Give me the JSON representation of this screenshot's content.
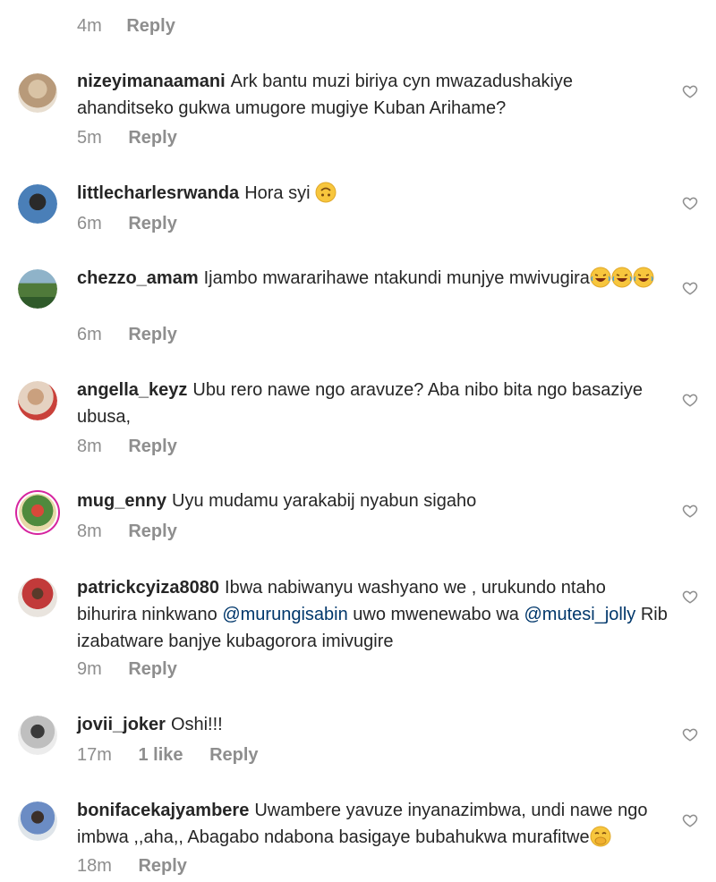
{
  "top": {
    "time": "4m",
    "reply_label": "Reply"
  },
  "comments": [
    {
      "username": "nizeyimanaamani",
      "text": "Ark bantu muzi biriya cyn mwazadushakiye ahanditseko gukwa umugore mugiye Kuban Arihame?",
      "time": "5m",
      "reply_label": "Reply"
    },
    {
      "username": "littlecharlesrwanda",
      "text": "Hora syi",
      "emoji": "upside-down-face",
      "time": "6m",
      "reply_label": "Reply"
    },
    {
      "username": "chezzo_amam",
      "text": "Ijambo mwararihawe ntakundi munjye mwivugira",
      "emoji": "tears-of-joy x3",
      "time": "6m",
      "reply_label": "Reply"
    },
    {
      "username": "angella_keyz",
      "text": "Ubu rero nawe ngo aravuze?  Aba nibo bita ngo basaziye ubusa,",
      "time": "8m",
      "reply_label": "Reply"
    },
    {
      "username": "mug_enny",
      "text": "Uyu mudamu yarakabij nyabun sigaho",
      "time": "8m",
      "reply_label": "Reply"
    },
    {
      "username": "patrickcyiza8080",
      "text_a": "Ibwa nabiwanyu washyano we , urukundo ntaho bihurira ninkwano ",
      "mention1": "@murungisabin",
      "text_b": " uwo mwenewabo wa ",
      "mention2": "@mutesi_jolly",
      "text_c": " Rib izabatware banjye kubagorora imivugire",
      "time": "9m",
      "reply_label": "Reply"
    },
    {
      "username": "jovii_joker",
      "text": "Oshi!!!",
      "time": "17m",
      "likes": "1 like",
      "reply_label": "Reply"
    },
    {
      "username": "bonifacekajyambere",
      "text": "Uwambere yavuze inyanazimbwa, undi nawe ngo imbwa ,,aha,, Abagabo ndabona basigaye bubahukwa murafitwe",
      "emoji": "hand-over-mouth",
      "time": "18m",
      "reply_label": "Reply"
    }
  ],
  "colors": {
    "text": "#262626",
    "meta": "#8e8e8e",
    "mention": "#00376b",
    "story_ring": "#d6249f"
  },
  "icons": {
    "like": "heart-outline-icon"
  }
}
